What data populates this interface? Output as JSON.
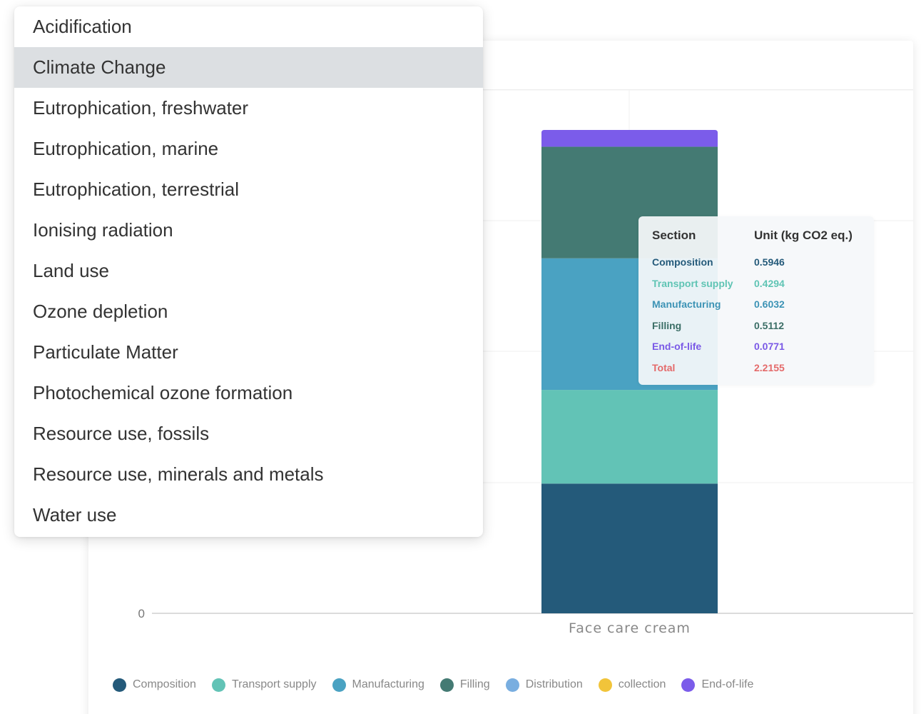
{
  "dropdown": {
    "selected_index": 1,
    "items": [
      "Acidification",
      "Climate Change",
      "Eutrophication, freshwater",
      "Eutrophication, marine",
      "Eutrophication, terrestrial",
      "Ionising radiation",
      "Land use",
      "Ozone depletion",
      "Particulate Matter",
      "Photochemical ozone formation",
      "Resource use, fossils",
      "Resource use, minerals and metals",
      "Water use"
    ]
  },
  "tooltip": {
    "section_header": "Section",
    "unit_header": "Unit (kg CO2 eq.)",
    "rows": [
      {
        "section": "Composition",
        "value": "0.5946",
        "color": "#245a7a"
      },
      {
        "section": "Transport supply",
        "value": "0.4294",
        "color": "#5fc4b4"
      },
      {
        "section": "Manufacturing",
        "value": "0.6032",
        "color": "#3c93b5"
      },
      {
        "section": "Filling",
        "value": "0.5112",
        "color": "#3b6e66"
      },
      {
        "section": "End-of-life",
        "value": "0.0771",
        "color": "#7a59e6"
      },
      {
        "section": "Total",
        "value": "2.2155",
        "color": "#e46a6a"
      }
    ]
  },
  "chart_data": {
    "type": "bar",
    "stacked": true,
    "categories": [
      "Face care cream"
    ],
    "y_tick_labels": [
      "0"
    ],
    "ylim": [
      0,
      2.2155
    ],
    "grid": true,
    "legend_position": "bottom",
    "series": [
      {
        "name": "Composition",
        "values": [
          0.5946
        ],
        "color": "#245a7a"
      },
      {
        "name": "Transport supply",
        "values": [
          0.4294
        ],
        "color": "#62c3b6"
      },
      {
        "name": "Manufacturing",
        "values": [
          0.6032
        ],
        "color": "#4aa2c2"
      },
      {
        "name": "Filling",
        "values": [
          0.5112
        ],
        "color": "#447a73"
      },
      {
        "name": "Distribution",
        "values": [
          0
        ],
        "color": "#79aee0"
      },
      {
        "name": "collection",
        "values": [
          0
        ],
        "color": "#f1c43a"
      },
      {
        "name": "End-of-life",
        "values": [
          0.0771
        ],
        "color": "#7b5cea"
      }
    ]
  }
}
